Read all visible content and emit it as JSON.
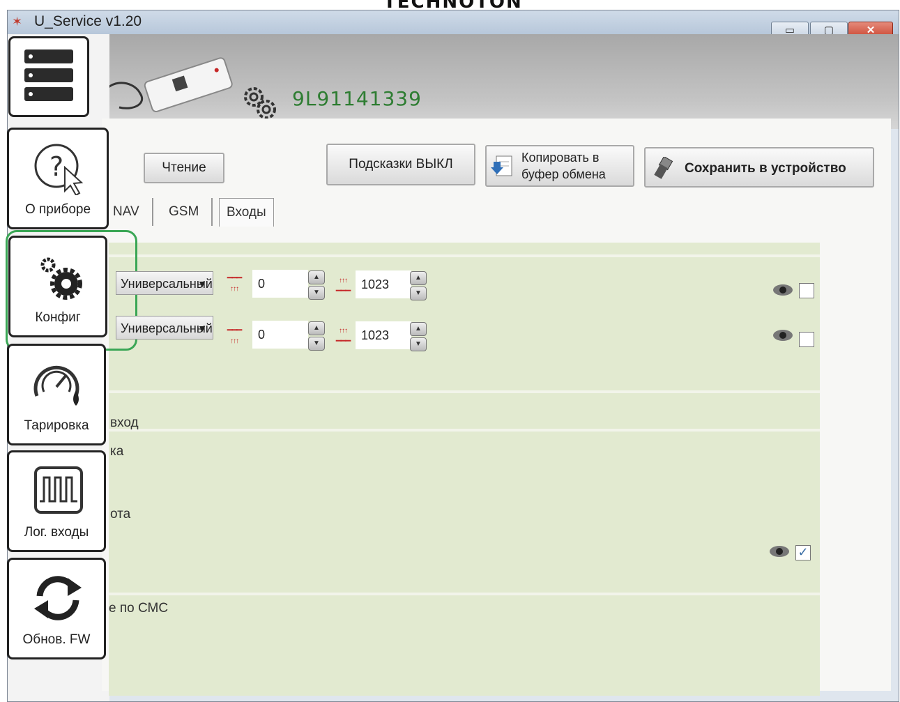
{
  "brand": "TECHNOTON",
  "window": {
    "title": "U_Service v1.20",
    "controls": {
      "minimize": "▭",
      "maximize": "▢",
      "close": "✕"
    }
  },
  "header": {
    "serial": "9L91141339"
  },
  "sidebar": {
    "items": [
      {
        "label": "О приборе",
        "icon": "help-cursor-icon"
      },
      {
        "label": "Конфиг",
        "icon": "gears-icon"
      },
      {
        "label": "Тарировка",
        "icon": "gauge-drop-icon"
      },
      {
        "label": "Лог. входы",
        "icon": "signal-chip-icon"
      },
      {
        "label": "Обнов. FW",
        "icon": "refresh-icon"
      }
    ]
  },
  "toolbar": {
    "read_label": "Чтение",
    "hints_label": "Подсказки ВЫКЛ",
    "copy_label_line1": "Копировать в",
    "copy_label_line2": "буфер обмена",
    "save_label": "Сохранить в устройство"
  },
  "tabs": [
    "NAV",
    "GSM",
    "Входы"
  ],
  "inputs": [
    {
      "mode": "Универсальный",
      "min": "0",
      "max": "1023",
      "checked": false
    },
    {
      "mode": "Универсальный",
      "min": "0",
      "max": "1023",
      "checked": false
    }
  ],
  "lower_rows": [
    "вход",
    "ка",
    "ота",
    "е по СМС"
  ],
  "lower_checkbox_checked": true
}
